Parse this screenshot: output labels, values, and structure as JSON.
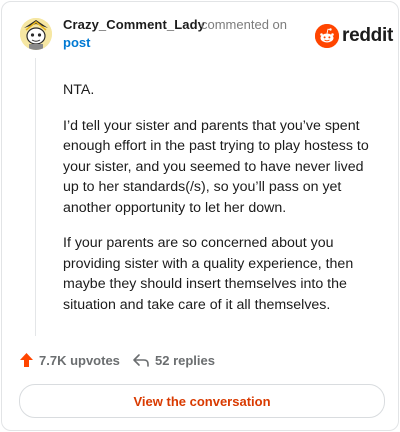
{
  "header": {
    "username": "Crazy_Comment_Lady",
    "action_text": "commented on",
    "context_link": "post",
    "brand_name": "reddit",
    "avatar_icon": "snoo-avatar-icon",
    "brand_icon": "reddit-logo-icon"
  },
  "comment": {
    "paragraphs": [
      "NTA.",
      "I’d tell your sister and parents that you’ve spent enough effort in the past trying to play hostess to your sister, and you seemed to have never lived up to her standards(/s), so you’ll pass on yet another opportunity to let her down.",
      "If your parents are so concerned about you providing sister with a quality experience, then maybe they should insert themselves into the situation and take care of it all themselves."
    ]
  },
  "stats": {
    "upvotes": "7.7K upvotes",
    "replies": "52 replies",
    "upvote_icon": "upvote-arrow-icon",
    "reply_icon": "reply-arrow-icon"
  },
  "cta": {
    "label": "View the conversation"
  },
  "colors": {
    "accent": "#d93a00",
    "brand": "#ff4500",
    "link": "#0079d3",
    "text": "#1c1c1c",
    "muted": "#7c7c7c"
  }
}
